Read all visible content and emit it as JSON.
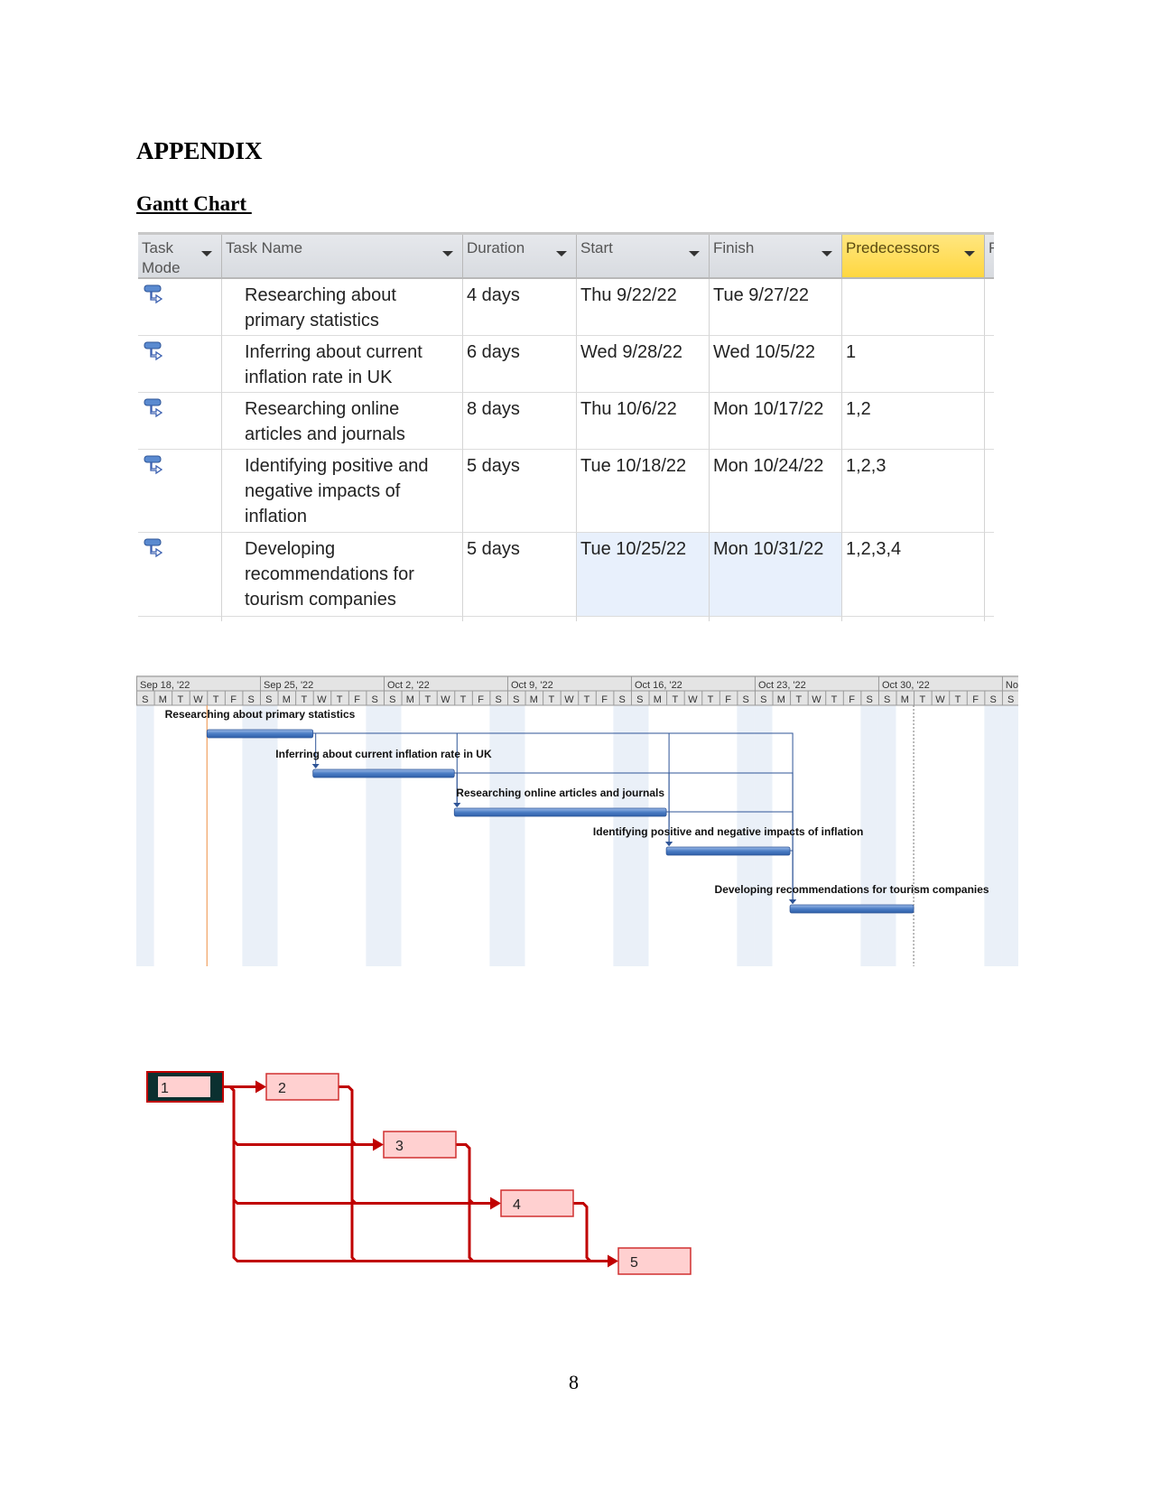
{
  "heading": "APPENDIX",
  "subheading": "Gantt Chart ",
  "page_number": "8",
  "table": {
    "columns": [
      {
        "label": "Task Mode",
        "dropdown": true
      },
      {
        "label": "Task Name",
        "dropdown": true
      },
      {
        "label": "Duration",
        "dropdown": true
      },
      {
        "label": "Start",
        "dropdown": true
      },
      {
        "label": "Finish",
        "dropdown": true
      },
      {
        "label": "Predecessors",
        "dropdown": true,
        "highlighted": true
      },
      {
        "label": "F",
        "dropdown": false
      }
    ],
    "rows": [
      {
        "mode_icon": "auto-scheduled-task-icon",
        "name": "Researching about primary statistics",
        "duration": "4 days",
        "start": "Thu 9/22/22",
        "finish": "Tue 9/27/22",
        "predecessors": ""
      },
      {
        "mode_icon": "auto-scheduled-task-icon",
        "name": "Inferring about current inflation rate in UK",
        "duration": "6 days",
        "start": "Wed 9/28/22",
        "finish": "Wed 10/5/22",
        "predecessors": "1"
      },
      {
        "mode_icon": "auto-scheduled-task-icon",
        "name": "Researching online articles and journals",
        "duration": "8 days",
        "start": "Thu 10/6/22",
        "finish": "Mon 10/17/22",
        "predecessors": "1,2"
      },
      {
        "mode_icon": "auto-scheduled-task-icon",
        "name": "Identifying positive and negative impacts of inflation",
        "duration": "5 days",
        "start": "Tue 10/18/22",
        "finish": "Mon 10/24/22",
        "predecessors": "1,2,3"
      },
      {
        "mode_icon": "auto-scheduled-task-icon",
        "name": "Developing recommendations for tourism companies",
        "duration": "5 days",
        "start": "Tue 10/25/22",
        "finish": "Mon 10/31/22",
        "predecessors": "1,2,3,4"
      }
    ],
    "header_highlight_color": "#ffd740",
    "selected_cells_color": "#e8f0fc"
  },
  "chart_data": {
    "type": "gantt",
    "timescale_weeks": [
      "Sep 18, '22",
      "Sep 25, '22",
      "Oct 2, '22",
      "Oct 9, '22",
      "Oct 16, '22",
      "Oct 23, '22",
      "Oct 30, '22",
      "No"
    ],
    "timescale_days": [
      "S",
      "M",
      "T",
      "W",
      "T",
      "F",
      "S",
      "S",
      "M",
      "T",
      "W",
      "T",
      "F",
      "S",
      "S",
      "M",
      "T",
      "W",
      "T",
      "F",
      "S",
      "S",
      "M",
      "T",
      "W",
      "T",
      "F",
      "S",
      "S",
      "M",
      "T",
      "W",
      "T",
      "F",
      "S",
      "S",
      "M",
      "T",
      "W",
      "T",
      "F",
      "S",
      "S",
      "M",
      "T",
      "W",
      "T",
      "F",
      "S",
      "S"
    ],
    "tasks": [
      {
        "label": "Researching about primary statistics",
        "start": "2022-09-22",
        "finish": "2022-09-27",
        "predecessors": []
      },
      {
        "label": "Inferring about current inflation rate in UK",
        "start": "2022-09-28",
        "finish": "2022-10-05",
        "predecessors": [
          1
        ]
      },
      {
        "label": "Researching online articles and journals",
        "start": "2022-10-06",
        "finish": "2022-10-17",
        "predecessors": [
          1,
          2
        ]
      },
      {
        "label": "Identifying positive and negative impacts of inflation",
        "start": "2022-10-18",
        "finish": "2022-10-24",
        "predecessors": [
          1,
          2,
          3
        ]
      },
      {
        "label": "Developing recommendations for tourism companies",
        "start": "2022-10-25",
        "finish": "2022-10-31",
        "predecessors": [
          1,
          2,
          3,
          4
        ]
      }
    ],
    "status_date": "2022-09-22",
    "project_finish_marker": "2022-11-01",
    "bar_color": "#4a7cc4",
    "link_color": "#2f5597",
    "status_line_color": "#f0a060",
    "weekend_shading_color": "#eaf0f8"
  },
  "network": {
    "nodes": [
      "1",
      "2",
      "3",
      "4",
      "5"
    ],
    "node_fill": "#ffd0d0",
    "line_color": "#c00000",
    "selected_node": "1"
  }
}
